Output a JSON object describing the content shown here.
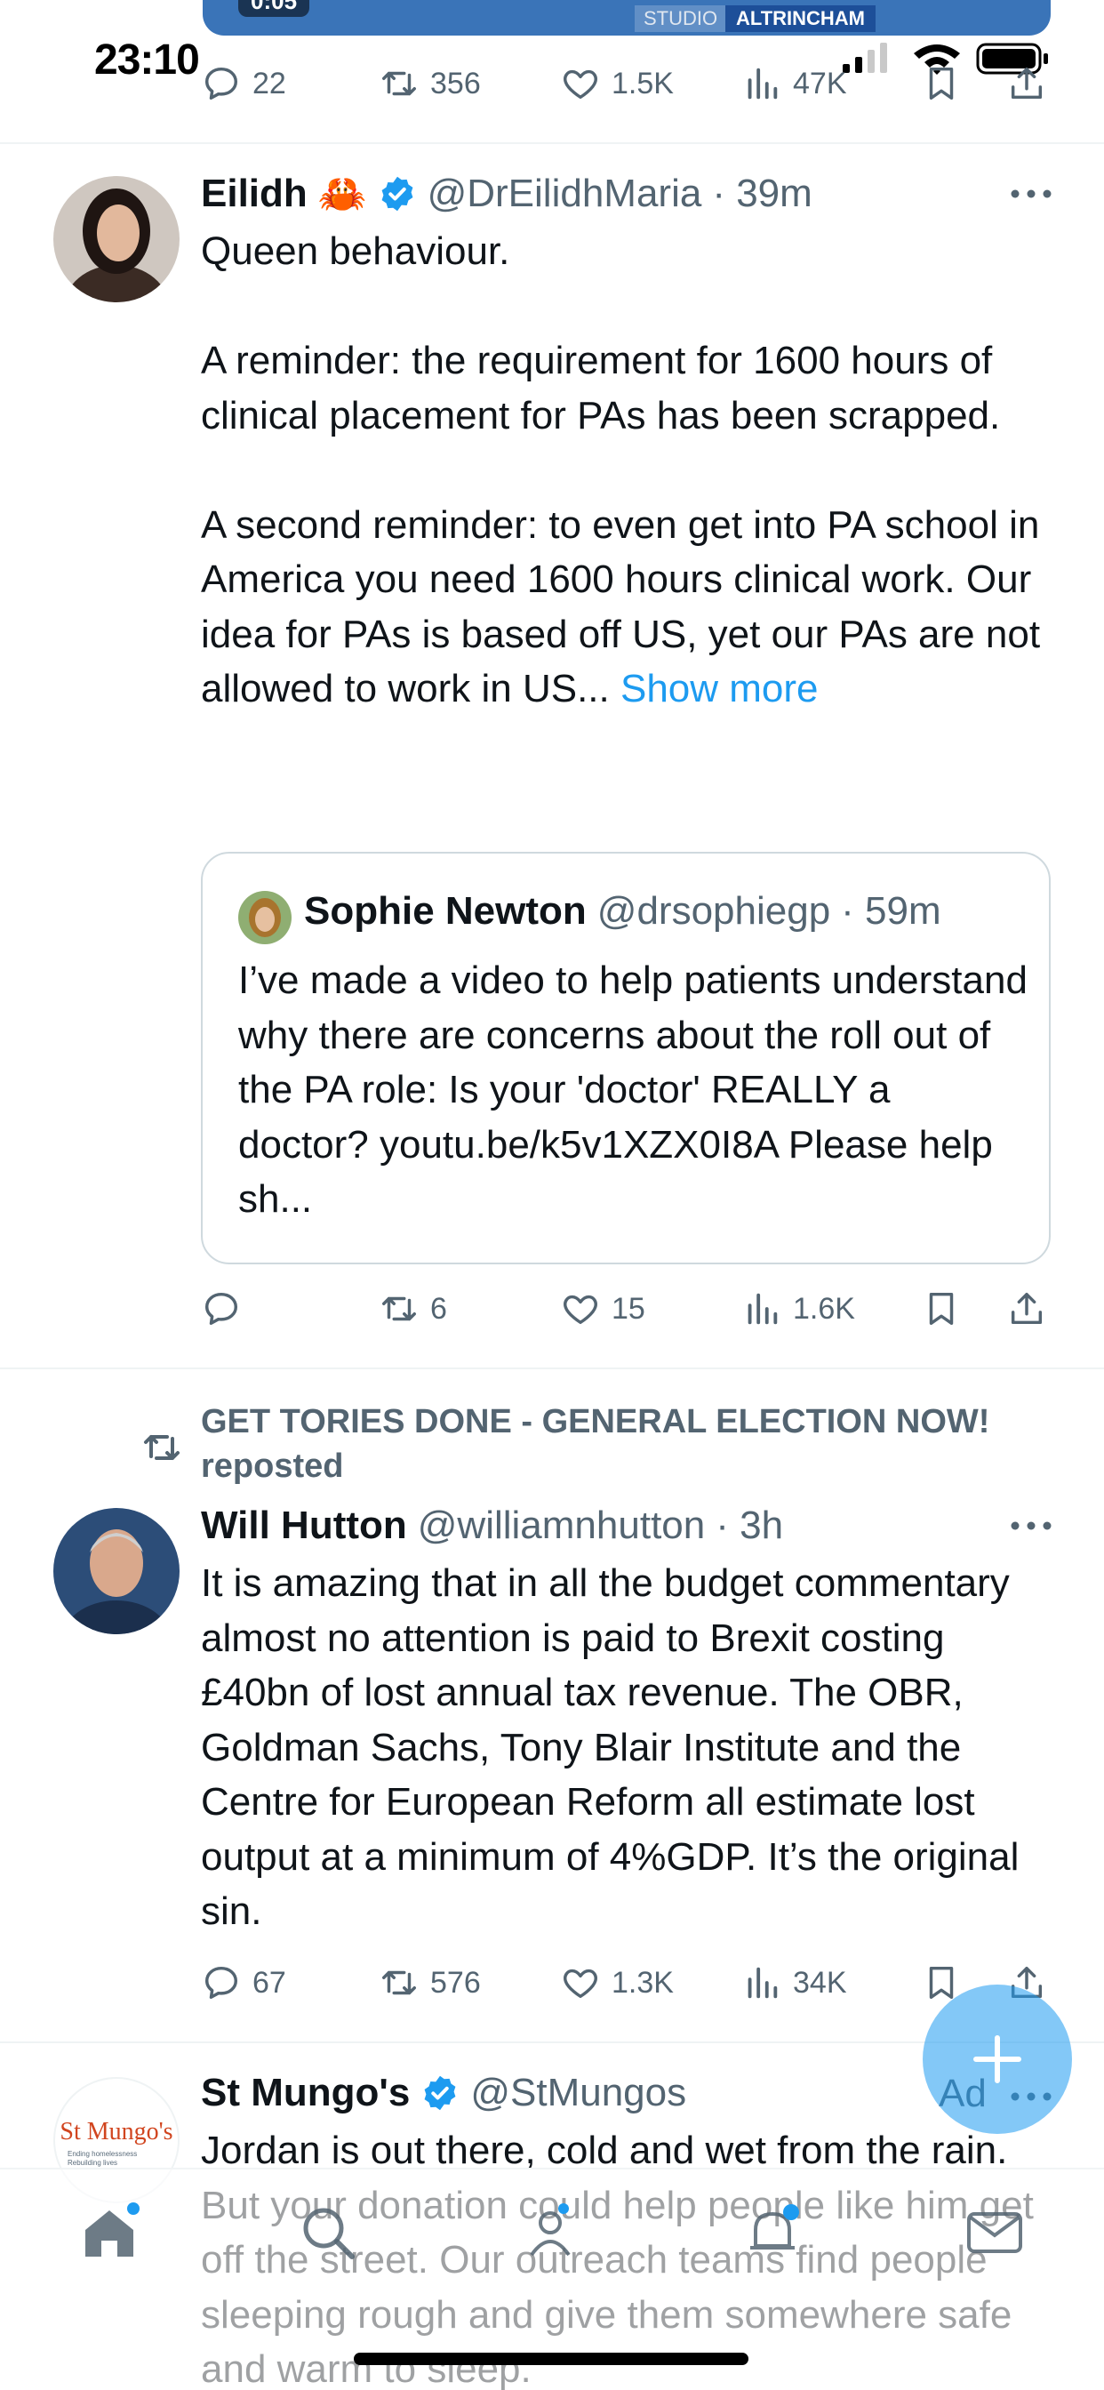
{
  "status_bar": {
    "time": "23:10"
  },
  "video_strip": {
    "time_label": "0:05",
    "studio": "STUDIO",
    "location": "ALTRINCHAM"
  },
  "tweet0_actions": {
    "replies": "22",
    "reposts": "356",
    "likes": "1.5K",
    "views": "47K"
  },
  "tweet1": {
    "name": "Eilidh",
    "emoji": "🦀",
    "handle": "@DrEilidhMaria",
    "time": "· 39m",
    "text": "Queen behaviour.\n\nA reminder: the requirement for 1600 hours of clinical placement for PAs has been scrapped.\n\nA second reminder: to even get into PA school in America you need 1600 hours clinical work. Our idea for PAs is based off US, yet our PAs are not allowed to work in US... ",
    "show_more": "Show more",
    "quote": {
      "name": "Sophie Newton",
      "handle": "@drsophiegp",
      "time": "· 59m",
      "text": "I’ve made a video to help patients understand why there are concerns about the roll out of the PA role: Is your 'doctor' REALLY a doctor? youtu.be/k5v1XZX0I8A Please help sh..."
    },
    "actions": {
      "replies": "",
      "reposts": "6",
      "likes": "15",
      "views": "1.6K"
    }
  },
  "tweet2": {
    "repost_label": "GET TORIES DONE - GENERAL ELECTION NOW! reposted",
    "name": "Will Hutton",
    "handle": "@williamnhutton",
    "time": "· 3h",
    "text": "It is amazing that in all the budget commentary  almost no attention is paid to Brexit costing £40bn of lost annual tax revenue. The OBR, Goldman Sachs, Tony Blair Institute and the Centre for European Reform all estimate lost output at a minimum of 4%GDP. It’s the original sin.",
    "actions": {
      "replies": "67",
      "reposts": "576",
      "likes": "1.3K",
      "views": "34K"
    }
  },
  "tweet3": {
    "name": "St Mungo's",
    "handle": "@StMungos",
    "ad_label": "Ad",
    "avatar_logo": "St Mungo's",
    "avatar_tagline": "Ending homelessness Rebuilding lives",
    "text": "Jordan is out there, cold and wet from the rain. But your donation could help people like him get off the street. Our outreach teams find people sleeping rough and give them somewhere safe and warm to sleep."
  },
  "colors": {
    "accent": "#1d9bf0",
    "text": "#0f1419",
    "muted": "#536471",
    "border": "#cfd9de"
  },
  "icons": [
    "reply-icon",
    "repost-icon",
    "like-icon",
    "views-icon",
    "bookmark-icon",
    "share-icon",
    "verified-badge-icon",
    "more-icon",
    "compose-icon",
    "home-icon",
    "search-icon",
    "communities-icon",
    "notifications-icon",
    "messages-icon"
  ]
}
